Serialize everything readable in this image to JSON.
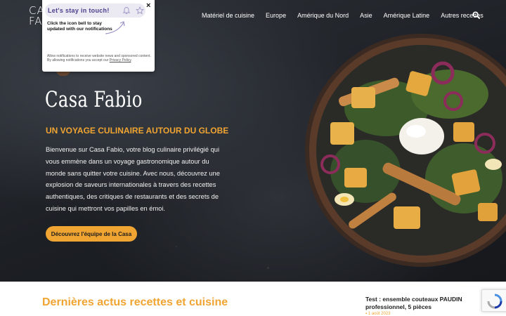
{
  "brand": {
    "logo_line1": "CASA",
    "logo_line2": "FABIO"
  },
  "nav": {
    "items": [
      {
        "label": "Matériel de cuisine"
      },
      {
        "label": "Europe"
      },
      {
        "label": "Amérique du Nord"
      },
      {
        "label": "Asie"
      },
      {
        "label": "Amérique Latine"
      },
      {
        "label": "Autres recettes"
      }
    ],
    "search_icon": "search-icon"
  },
  "notification": {
    "title": "Let's stay in touch!",
    "body": "Click the icon bell to stay updated with our notifications",
    "legal": "Allow notifications to receive website news and sponsored content. By allowing notifications you accept our",
    "legal_link": "Privacy Policy",
    "close_label": "×",
    "icons": [
      "bell-icon",
      "star-icon",
      "close-icon"
    ]
  },
  "hero": {
    "title": "Casa Fabio",
    "subtitle": "UN VOYAGE CULINAIRE AUTOUR DU GLOBE",
    "text": "Bienvenue sur Casa Fabio, votre blog culinaire privilégié qui vous emmène dans un voyage gastronomique autour du monde sans quitter votre cuisine. Avec nous, découvrez une explosion de saveurs internationales à travers des recettes authentiques, des critiques de restaurants et des secrets de cuisine qui mettront vos papilles en émoi.",
    "button_label": "Découvrez l'équipe de la Casa"
  },
  "latest": {
    "section_title": "Dernières actus recettes et cuisine",
    "article_title": "Test : ensemble couteaux PAUDIN professionnel, 5 pièces",
    "article_date": "1 août 2023"
  },
  "colors": {
    "accent": "#f0a432",
    "popup_title": "#4a3f8c",
    "hero_bg": "#23262b"
  }
}
